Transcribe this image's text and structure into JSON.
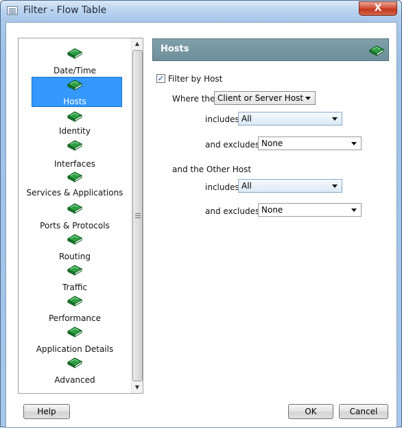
{
  "window": {
    "title": "Filter - Flow Table",
    "close_label": "X"
  },
  "nav": {
    "items": [
      {
        "label": "Date/Time",
        "selected": false
      },
      {
        "label": "Hosts",
        "selected": true
      },
      {
        "label": "Identity",
        "selected": false
      },
      {
        "label": "Interfaces",
        "selected": false
      },
      {
        "label": "Services & Applications",
        "selected": false
      },
      {
        "label": "Ports & Protocols",
        "selected": false
      },
      {
        "label": "Routing",
        "selected": false
      },
      {
        "label": "Traffic",
        "selected": false
      },
      {
        "label": "Performance",
        "selected": false
      },
      {
        "label": "Application Details",
        "selected": false
      },
      {
        "label": "Advanced",
        "selected": false
      }
    ],
    "icon": "green-book-icon",
    "selected_color": "#3399ff"
  },
  "section": {
    "title": "Hosts",
    "header_color": "#7a9ba5"
  },
  "filter": {
    "checkbox_label": "Filter by Host",
    "checked": true,
    "check_glyph": "✓",
    "where_label": "Where the",
    "host_select": "Client or Server Host",
    "includes_label_1": "includes",
    "includes_value_1": "All",
    "excludes_label_1": "and excludes",
    "excludes_value_1": "None",
    "other_host_label": "and the Other Host",
    "includes_label_2": "includes",
    "includes_value_2": "All",
    "excludes_label_2": "and excludes",
    "excludes_value_2": "None"
  },
  "buttons": {
    "help": "Help",
    "ok": "OK",
    "cancel": "Cancel"
  },
  "scroll": {
    "up_glyph": "▲",
    "down_glyph": "▼"
  }
}
